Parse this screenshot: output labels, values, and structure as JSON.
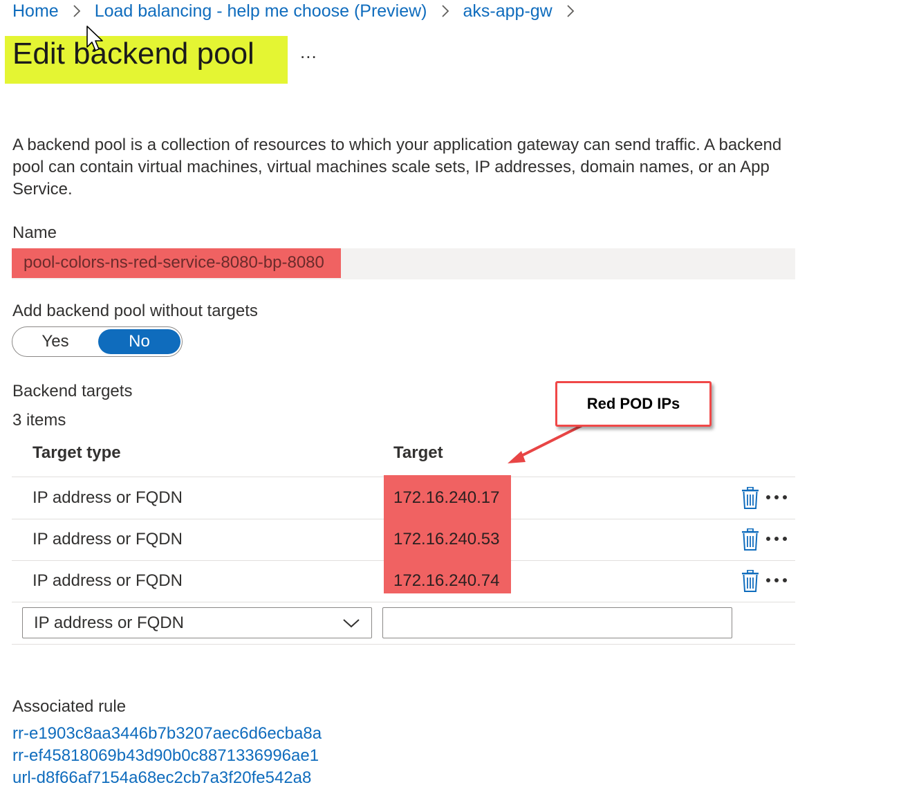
{
  "breadcrumb": {
    "items": [
      "Home",
      "Load balancing - help me choose (Preview)",
      "aks-app-gw"
    ]
  },
  "page": {
    "title": "Edit backend pool",
    "more": "...",
    "description": "A backend pool is a collection of resources to which your application gateway can send traffic. A backend pool can contain virtual machines, virtual machines scale sets, IP addresses, domain names, or an App Service."
  },
  "name_field": {
    "label": "Name",
    "value": "pool-colors-ns-red-service-8080-bp-8080"
  },
  "without_targets": {
    "label": "Add backend pool without targets",
    "yes": "Yes",
    "no": "No",
    "selected": "No"
  },
  "backend_targets": {
    "title": "Backend targets",
    "count": "3 items",
    "col_type": "Target type",
    "col_target": "Target",
    "rows": [
      {
        "type": "IP address or FQDN",
        "target": "172.16.240.17"
      },
      {
        "type": "IP address or FQDN",
        "target": "172.16.240.53"
      },
      {
        "type": "IP address or FQDN",
        "target": "172.16.240.74"
      }
    ],
    "new_row": {
      "type_select": "IP address or FQDN",
      "target_value": ""
    }
  },
  "callout": {
    "text": "Red POD IPs"
  },
  "associated_rule": {
    "label": "Associated rule",
    "links": [
      "rr-e1903c8aa3446b7b3207aec6d6ecba8a",
      "rr-ef45818069b43d90b0c8871336996ae1",
      "url-d8f66af7154a68ec2cb7a3f20fe542a8"
    ]
  },
  "colors": {
    "link": "#0f6cbd",
    "title_highlight": "#e4f533",
    "red_highlight": "#f06262",
    "toggle_active": "#0f6cbd"
  },
  "icons": [
    "chevron-right-icon",
    "mouse-cursor-icon",
    "trash-icon",
    "more-icon",
    "chevron-down-icon"
  ]
}
